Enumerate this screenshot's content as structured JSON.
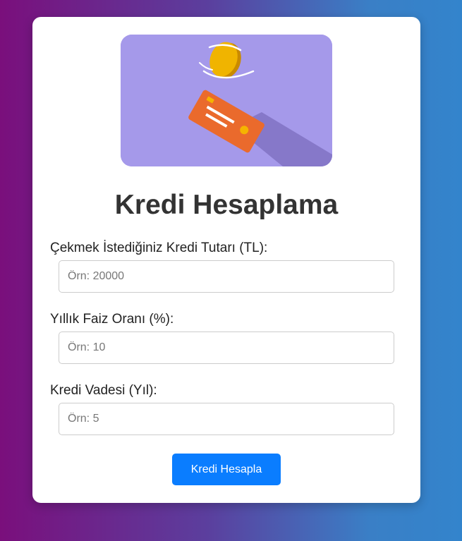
{
  "page": {
    "title": "Kredi Hesaplama"
  },
  "hero": {
    "image_icon": "credit-card-coin-illustration",
    "colors": {
      "background": "#a599ea",
      "card": "#ea6a2c",
      "coin": "#f0b400"
    }
  },
  "form": {
    "amount": {
      "label": "Çekmek İstediğiniz Kredi Tutarı (TL):",
      "placeholder": "Örn: 20000",
      "value": ""
    },
    "rate": {
      "label": "Yıllık Faiz Oranı (%):",
      "placeholder": "Örn: 10",
      "value": ""
    },
    "term": {
      "label": "Kredi Vadesi (Yıl):",
      "placeholder": "Örn: 5",
      "value": ""
    },
    "submit_label": "Kredi Hesapla"
  },
  "colors": {
    "button": "#0a7dff",
    "title": "#333333",
    "gradient_start": "#7a0f7c",
    "gradient_end": "#3384cc"
  }
}
